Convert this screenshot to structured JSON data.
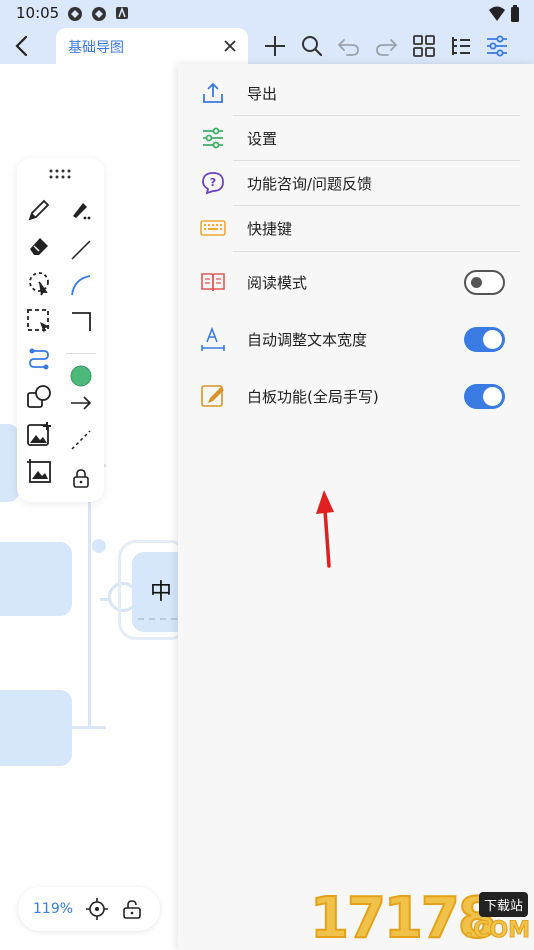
{
  "status_bar": {
    "time": "10:05"
  },
  "toolbar": {
    "tab_title": "基础导图"
  },
  "canvas": {
    "central_node_text": "中"
  },
  "zoom": {
    "level": "119%"
  },
  "panel": {
    "items": [
      {
        "label": "导出",
        "icon": "export-icon"
      },
      {
        "label": "设置",
        "icon": "settings-sliders-icon"
      },
      {
        "label": "功能咨询/问题反馈",
        "icon": "help-icon"
      },
      {
        "label": "快捷键",
        "icon": "keyboard-icon"
      },
      {
        "label": "阅读模式",
        "icon": "book-icon",
        "toggle": false
      },
      {
        "label": "自动调整文本宽度",
        "icon": "text-width-icon",
        "toggle": true
      },
      {
        "label": "白板功能(全局手写)",
        "icon": "whiteboard-icon",
        "toggle": true
      }
    ]
  },
  "watermark": {
    "digits": "17178",
    "badge": "下载站",
    "suffix": ".COM"
  },
  "colors": {
    "accent": "#3a7be3",
    "header_bg": "#dbe7fa",
    "node_fill": "#d6e6fb",
    "arrow": "#e02020"
  }
}
